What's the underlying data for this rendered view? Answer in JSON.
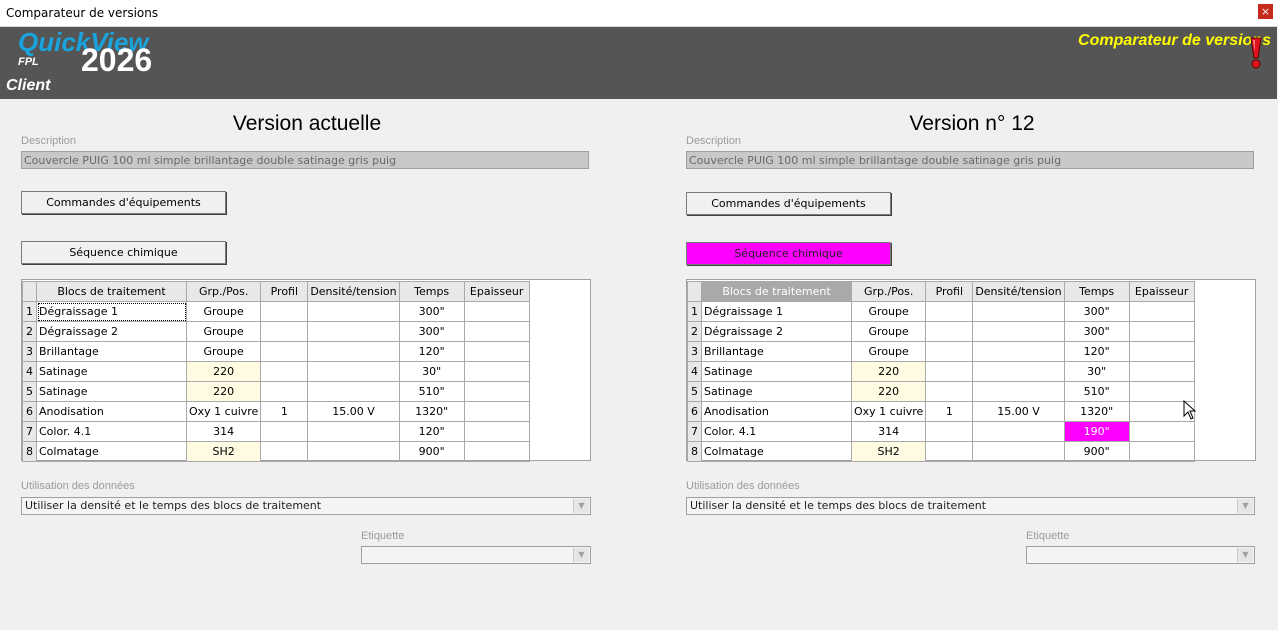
{
  "window": {
    "title": "Comparateur de versions",
    "close_glyph": "×"
  },
  "header": {
    "logo_quickview": "QuickView",
    "logo_fpl": "FPL",
    "logo_year": "2026",
    "logo_client": "Client",
    "title": "Comparateur de versions",
    "alert_icon": "exclamation-icon",
    "title_color": "#ffff00"
  },
  "left": {
    "title": "Version actuelle",
    "description_label": "Description",
    "description_value": "Couvercle PUIG 100 ml simple brillantage double satinage  gris puig",
    "btn_equipment": "Commandes d'équipements",
    "btn_chemical": "Séquence chimique",
    "columns": [
      "Blocs de traitement",
      "Grp./Pos.",
      "Profil",
      "Densité/tension",
      "Temps",
      "Epaisseur"
    ],
    "rows": [
      {
        "n": "1",
        "name": "Dégraissage 1",
        "grp": "Groupe",
        "profil": "",
        "dens": "",
        "temps": "300\"",
        "ep": ""
      },
      {
        "n": "2",
        "name": "Dégraissage 2",
        "grp": "Groupe",
        "profil": "",
        "dens": "",
        "temps": "300\"",
        "ep": ""
      },
      {
        "n": "3",
        "name": "Brillantage",
        "grp": "Groupe",
        "profil": "",
        "dens": "",
        "temps": "120\"",
        "ep": ""
      },
      {
        "n": "4",
        "name": "Satinage",
        "grp": "220",
        "profil": "",
        "dens": "",
        "temps": "30\"",
        "ep": ""
      },
      {
        "n": "5",
        "name": "Satinage",
        "grp": "220",
        "profil": "",
        "dens": "",
        "temps": "510\"",
        "ep": ""
      },
      {
        "n": "6",
        "name": "Anodisation",
        "grp": "Oxy 1 cuivre",
        "profil": "1",
        "dens": "15.00 V",
        "temps": "1320\"",
        "ep": ""
      },
      {
        "n": "7",
        "name": "Color. 4.1",
        "grp": "314",
        "profil": "",
        "dens": "",
        "temps": "120\"",
        "ep": ""
      },
      {
        "n": "8",
        "name": "Colmatage",
        "grp": "SH2",
        "profil": "",
        "dens": "",
        "temps": "900\"",
        "ep": ""
      }
    ],
    "usage_label": "Utilisation des données",
    "usage_value": "Utiliser la densité et le temps des blocs de traitement",
    "etiquette_label": "Etiquette",
    "etiquette_value": ""
  },
  "right": {
    "title": "Version n° 12",
    "description_label": "Description",
    "description_value": "Couvercle PUIG 100 ml simple brillantage double satinage  gris puig",
    "btn_equipment": "Commandes d'équipements",
    "btn_chemical": "Séquence chimique",
    "columns": [
      "Blocs de traitement",
      "Grp./Pos.",
      "Profil",
      "Densité/tension",
      "Temps",
      "Epaisseur"
    ],
    "rows": [
      {
        "n": "1",
        "name": "Dégraissage 1",
        "grp": "Groupe",
        "profil": "",
        "dens": "",
        "temps": "300\"",
        "ep": ""
      },
      {
        "n": "2",
        "name": "Dégraissage 2",
        "grp": "Groupe",
        "profil": "",
        "dens": "",
        "temps": "300\"",
        "ep": ""
      },
      {
        "n": "3",
        "name": "Brillantage",
        "grp": "Groupe",
        "profil": "",
        "dens": "",
        "temps": "120\"",
        "ep": ""
      },
      {
        "n": "4",
        "name": "Satinage",
        "grp": "220",
        "profil": "",
        "dens": "",
        "temps": "30\"",
        "ep": ""
      },
      {
        "n": "5",
        "name": "Satinage",
        "grp": "220",
        "profil": "",
        "dens": "",
        "temps": "510\"",
        "ep": ""
      },
      {
        "n": "6",
        "name": "Anodisation",
        "grp": "Oxy 1 cuivre",
        "profil": "1",
        "dens": "15.00 V",
        "temps": "1320\"",
        "ep": ""
      },
      {
        "n": "7",
        "name": "Color. 4.1",
        "grp": "314",
        "profil": "",
        "dens": "",
        "temps": "190\"",
        "ep": ""
      },
      {
        "n": "8",
        "name": "Colmatage",
        "grp": "SH2",
        "profil": "",
        "dens": "",
        "temps": "900\"",
        "ep": ""
      }
    ],
    "usage_label": "Utilisation des données",
    "usage_value": "Utiliser la densité et le temps des blocs de traitement",
    "etiquette_label": "Etiquette",
    "etiquette_value": ""
  },
  "colors": {
    "diff_highlight": "#ff00ff",
    "header_bg": "#555555",
    "logo_blue": "#1aa3dc",
    "yellow_cell": "#fffbe3"
  }
}
